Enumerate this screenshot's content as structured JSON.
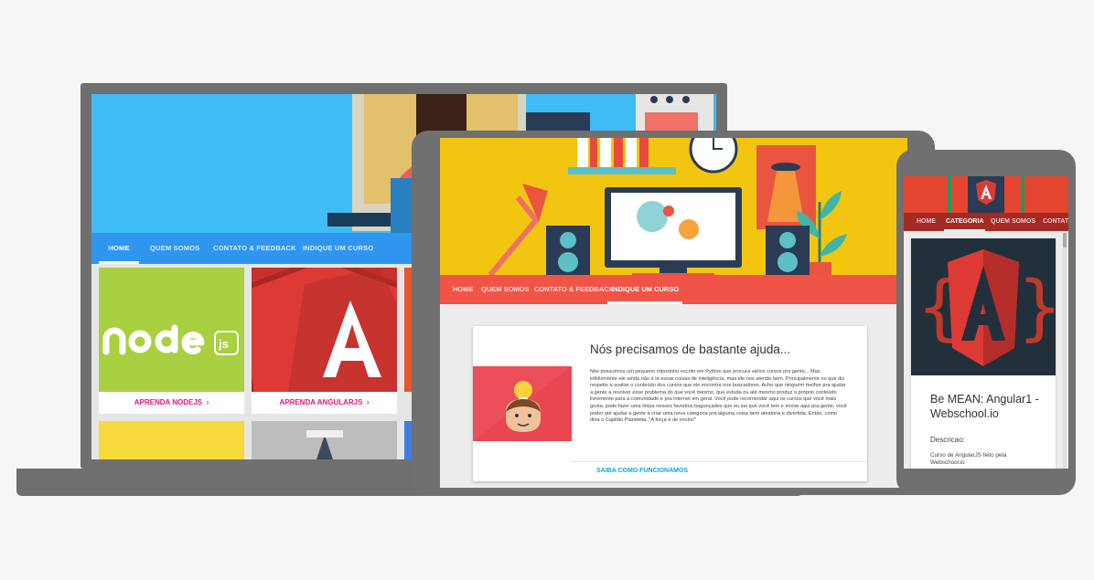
{
  "colors": {
    "laptop_nav": "#2f96f0",
    "tablet_nav": "#f05447",
    "phone_nav": "#a52a24",
    "accent_pink": "#e0187a",
    "accent_link": "#16a2d6"
  },
  "laptop": {
    "nav": [
      {
        "label": "HOME",
        "active": true
      },
      {
        "label": "QUEM SOMOS",
        "active": false
      },
      {
        "label": "CONTATO & FEEDBACK",
        "active": false
      },
      {
        "label": "INDIQUE UM CURSO",
        "active": false
      }
    ],
    "cards": [
      {
        "link": "APRENDA NODEJS",
        "icon": "nodejs-logo"
      },
      {
        "link": "APRENDA ANGULARJS",
        "icon": "angular-logo"
      }
    ]
  },
  "tablet": {
    "nav": [
      {
        "label": "HOME",
        "active": false
      },
      {
        "label": "QUEM SOMOS",
        "active": false
      },
      {
        "label": "CONTATO & FEEDBACK",
        "active": false
      },
      {
        "label": "INDIQUE UM CURSO",
        "active": true
      }
    ],
    "article": {
      "title": "Nós precisamos de bastante ajuda...",
      "body": "Nós possuímos um pequeno robozinho escrito em Python que procura vários cursos pra gente... Mas infelizmente ele ainda não é lá essas coisas de inteligência, mas ele nos atende bem. Principalmente no que diz respeito a avaliar o conteúdo dos cursos que ele encontra nos buscadores. Acho que ninguém melhor pra ajudar a gente a resolver esse problema do que você mesmo, que estuda ou até mesmo produz o próprio conteúdo livremente para a comunidade e pra internet em geral. Você pode recomendar aqui os cursos que você mais gosta, pode fazer uma limpa nesses favoritos bagunçados que eu sei que você tem e enviar aqui pra gente, você poder até ajudar a gente a criar uma nova categoria pra alguma coisa bem aleatória e divertida. Então, como diria o Capitão Planeteta: \"A força é de vocês!\"",
      "link": "SAIBA COMO FUNCIONAMOS",
      "icon": "lightbulb-character-icon"
    }
  },
  "phone": {
    "nav": [
      {
        "label": "HOME",
        "active": false
      },
      {
        "label": "CATEGORIA",
        "active": true
      },
      {
        "label": "QUEM SOMOS",
        "active": false
      },
      {
        "label": "CONTATO",
        "active": false
      }
    ],
    "card": {
      "title": "Be MEAN: Angular1 - Webschool.io",
      "label": "Descricao:",
      "description": "Curso de AngularJS feito pela Webschool.io",
      "icon": "angular-logo"
    }
  }
}
